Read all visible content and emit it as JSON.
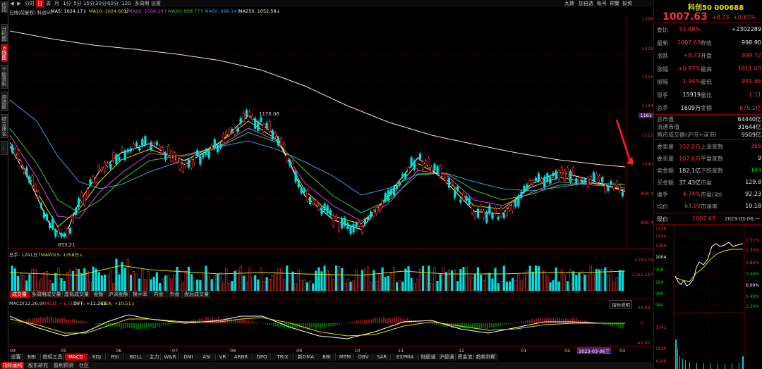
{
  "sidebar": {
    "items": [
      "应用",
      "分时图",
      "K线图",
      "个股资料",
      "自选股",
      "综合排名",
      "牛叉诊股",
      "超级盘口",
      "主力大单",
      "..."
    ]
  },
  "topbar": {
    "nav_icons": [
      "◀",
      "▶"
    ],
    "periods": [
      "分时",
      "日",
      "周",
      "月",
      "1分",
      "5分",
      "15分",
      "30分",
      "60分",
      "120分",
      "多周期",
      "设置"
    ],
    "active_period": "日",
    "right_tools": [
      "九转",
      "加自选",
      "账号",
      "预警",
      "投资"
    ]
  },
  "ma": {
    "label": "日线(前复权) 科创50",
    "ma5": "MA5: 1024.17↓",
    "ma10": "MA10: 1024.60↓",
    "ma20": "MA20: 1006.29↑",
    "ma30": "MA30: 998.77↑",
    "ma60": "MA60: 998.14↓",
    "ma250": "MA250: 1052.58↓"
  },
  "price_axis": [
    "1399",
    "1328",
    "1256",
    "1184",
    "1112",
    "1040",
    "968.4",
    "896.4"
  ],
  "price_axis_highlight": "1161",
  "annotations": {
    "high": "1176.06",
    "low": "853.21"
  },
  "volume": {
    "label": "总手: 1241万↑",
    "mavol": "MAVOL5: 1358万↓",
    "axis": [
      "2294.04",
      "1161.187"
    ]
  },
  "tabs1": [
    "成交量",
    "多周期成交量",
    "虚拟成交量",
    "金额",
    "沪深金额",
    "换手率",
    "内盘",
    "外盘",
    "盘后成交量"
  ],
  "macd": {
    "label": "MACD(12,26,9)",
    "macd": "MACD: +1.51↑",
    "diff": "DIFF: +11.26↓",
    "dea": "DEA: +10.51↓",
    "button": "指标说明",
    "axis": [
      "34.44",
      "0",
      "-40.81"
    ]
  },
  "months": [
    "04",
    "05",
    "06",
    "07",
    "08",
    "09",
    "10",
    "11",
    "12",
    "01",
    "02",
    "2023-03-06三",
    "03"
  ],
  "tabs2": [
    "设置",
    "BBI",
    "指标工具",
    "MACD",
    "KDJ",
    "RSI",
    "BOLL",
    "主力",
    "W&R",
    "DMI",
    "ASI",
    "VR",
    "ARBR",
    "DPO",
    "TRIX",
    "新DMA",
    "BBI",
    "MTM",
    "OBV",
    "SAR",
    "EXPMA",
    "陆股通",
    "沪股通",
    "资金流",
    "趋势判断"
  ],
  "bottom_tabs": [
    "指标画线",
    "股东研究",
    "盈利预测",
    "社区"
  ],
  "quote": {
    "name": "科创50",
    "code": "000688",
    "price": "1007.63",
    "change": "+8.73",
    "pct": "+0.87%",
    "rows": [
      {
        "l": "委比",
        "v": "51.68%",
        "v2": "+2302289"
      },
      {
        "l": "最新",
        "v": "1007.63",
        "l2": "昨收",
        "v2": "998.90"
      },
      {
        "l": "涨跌",
        "v": "+8.73",
        "l2": "开盘",
        "v2": "999.72"
      },
      {
        "l": "涨幅",
        "v": "+0.87%",
        "l2": "最高",
        "v2": "1011.03"
      },
      {
        "l": "振幅",
        "v": "1.94%",
        "l2": "最低",
        "v2": "991.66"
      },
      {
        "l": "现手",
        "v": "15919",
        "l2": "量比",
        "v2": "1.11"
      },
      {
        "l": "总手",
        "v": "1609万",
        "l2": "金额",
        "v2": "675.1亿"
      }
    ],
    "market": [
      {
        "l": "总市值",
        "v": "64440亿"
      },
      {
        "l": "流通市值",
        "v": "31644亿"
      },
      {
        "l": "两市成交额(沪市+深市)",
        "v": "9509亿"
      }
    ],
    "rows2": [
      {
        "l": "委卖量",
        "v": "337.0万",
        "l2": "上涨家数",
        "v2": "355"
      },
      {
        "l": "委买量",
        "v": "107.6万",
        "l2": "平盘家数",
        "v2": "9"
      },
      {
        "l": "卖金额",
        "v": "182.1亿",
        "l2": "下跌家数",
        "v2": "144"
      },
      {
        "l": "买金额",
        "v": "37.43亿",
        "l2": "市盈",
        "v2": "129.8"
      },
      {
        "l": "换手",
        "v": "4.74%",
        "l2": "市盈(动)",
        "v2": "92.23"
      },
      {
        "l": "均价",
        "v": "63.99",
        "l2": "市净率",
        "v2": "10.18"
      }
    ],
    "now": {
      "l": "现价",
      "v": "1007.63",
      "d": "2023-03-06,一"
    },
    "mini_axis_left": [
      "1319",
      "1314",
      "1309",
      "1004",
      "999",
      "994",
      "989",
      "984"
    ],
    "mini_axis_right": [
      "1.51%",
      "1.30%",
      "0.86%",
      "0.49%",
      "0.00%",
      "0.49%",
      "1.30%"
    ],
    "mini_vol": [
      "3741",
      "1930",
      "X100"
    ]
  }
}
